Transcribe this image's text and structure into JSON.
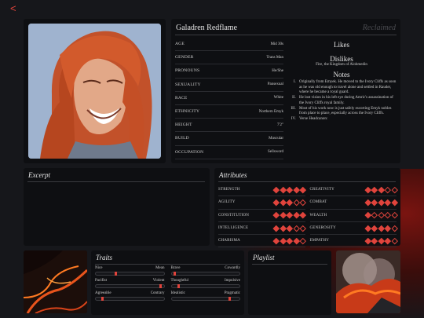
{
  "nav": {
    "back_glyph": "<"
  },
  "character": {
    "name": "Galadren Redflame",
    "status": "Reclaimed",
    "stats": [
      {
        "key": "AGE",
        "value": "Mid 30s"
      },
      {
        "key": "GENDER",
        "value": "Trans Man"
      },
      {
        "key": "PRONOUNS",
        "value": "He/She"
      },
      {
        "key": "SEXUALITY",
        "value": "Pansexual"
      },
      {
        "key": "RACE",
        "value": "White"
      },
      {
        "key": "ETHNICITY",
        "value": "Northern Emyk"
      },
      {
        "key": "HEIGHT",
        "value": "7'2\""
      },
      {
        "key": "BUILD",
        "value": "Muscular"
      },
      {
        "key": "OCCUPATION",
        "value": "Sellsword"
      }
    ],
    "likes_title": "Likes",
    "likes_text": "",
    "dislikes_title": "Dislikes",
    "dislikes_text": "Fire, the Kingdom of Alohmedin",
    "notes_title": "Notes",
    "notes": [
      "Originally from Emyek. He moved to the Ivory Cliffs as soon as he was old enough to travel alone and settled in Rauder, where he became a royal guard.",
      "He lost vision in his left eye during Amric's assassination of the Ivory Cliffs royal family.",
      "Most of his work now is just safely escorting Emyk nobles from place to place, especially across the Ivory Cliffs.",
      "Verse Headcanon:"
    ]
  },
  "excerpt": {
    "title": "Excerpt",
    "text": ""
  },
  "attributes": {
    "title": "Attributes",
    "accent_color": "#e0443c",
    "items": [
      {
        "name": "STRENGTH",
        "level": 5,
        "max": 5
      },
      {
        "name": "CREATIVITY",
        "level": 3,
        "max": 5
      },
      {
        "name": "AGILITY",
        "level": 3,
        "max": 5
      },
      {
        "name": "COMBAT",
        "level": 5,
        "max": 5
      },
      {
        "name": "CONSTITUTION",
        "level": 5,
        "max": 5
      },
      {
        "name": "WEALTH",
        "level": 1,
        "max": 5
      },
      {
        "name": "INTELLIGENCE",
        "level": 3,
        "max": 5
      },
      {
        "name": "GENEROSITY",
        "level": 4,
        "max": 5
      },
      {
        "name": "CHARISMA",
        "level": 4,
        "max": 5
      },
      {
        "name": "EMPATHY",
        "level": 4,
        "max": 5
      }
    ]
  },
  "traits": {
    "title": "Traits",
    "items": [
      {
        "left": "Nice",
        "right": "Mean",
        "value": 0.3
      },
      {
        "left": "Brave",
        "right": "Cowardly",
        "value": 0.05
      },
      {
        "left": "Pacifist",
        "right": "Violent",
        "value": 0.95
      },
      {
        "left": "Thoughtful",
        "right": "Impulsive",
        "value": 0.1
      },
      {
        "left": "Agreeable",
        "right": "Contrary",
        "value": 0.1
      },
      {
        "left": "Idealistic",
        "right": "Pragmatic",
        "value": 0.85
      }
    ]
  },
  "playlist": {
    "title": "Playlist"
  }
}
